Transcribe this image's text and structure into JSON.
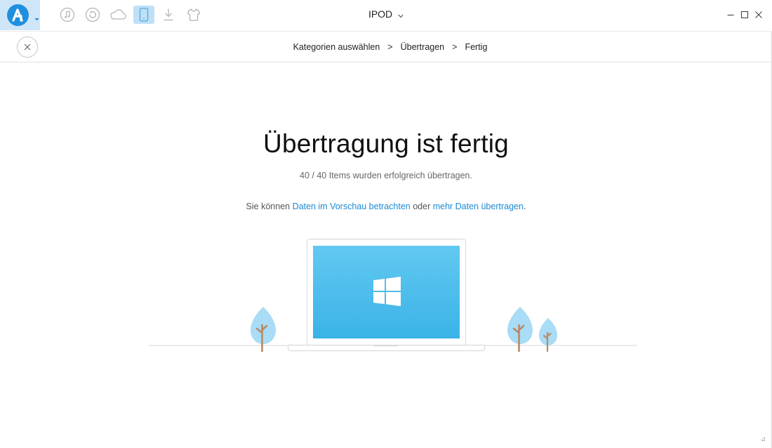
{
  "toolbar": {
    "icons": [
      "app-logo-icon",
      "music-note-icon",
      "restore-icon",
      "cloud-icon",
      "phone-icon",
      "download-icon",
      "tshirt-icon"
    ],
    "active_icon": "phone-icon",
    "device_name": "IPOD"
  },
  "breadcrumb": {
    "step1": "Kategorien auswählen",
    "step2": "Übertragen",
    "step3": "Fertig",
    "separator": ">"
  },
  "main": {
    "title": "Übertragung ist fertig",
    "subtitle": "40 / 40 Items wurden erfolgreich übertragen.",
    "info_prefix": "Sie können ",
    "link_preview": "Daten im Vorschau betrachten",
    "info_middle": " oder ",
    "link_more": "mehr Daten übertragen",
    "info_suffix": "."
  },
  "colors": {
    "accent": "#1a8ad4",
    "logo": "#1f8fe0",
    "screen": "#4fbeee",
    "tree": "#a9dcf6",
    "trunk": "#b88a64"
  }
}
